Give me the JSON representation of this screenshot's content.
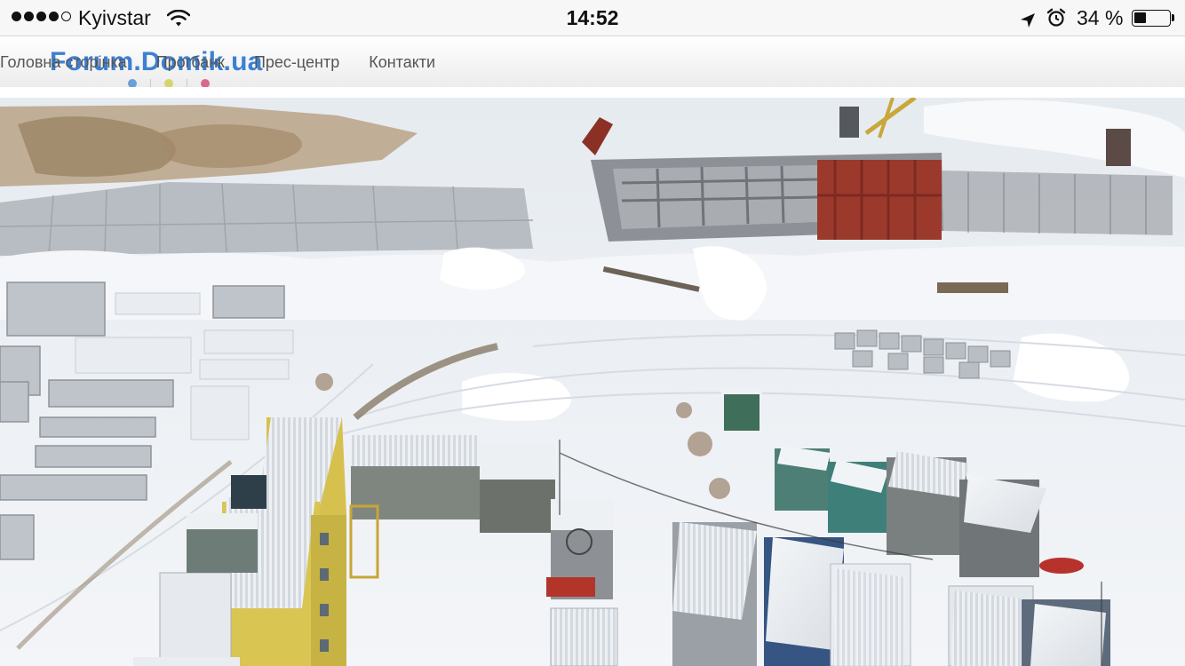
{
  "status_bar": {
    "carrier": "Kyivstar",
    "time": "14:52",
    "battery_percent": "34 %",
    "battery_level": 0.34,
    "icons": [
      "signal-dots-icon",
      "wifi-icon",
      "location-arrow-icon",
      "alarm-clock-icon",
      "battery-icon"
    ]
  },
  "header": {
    "logo": "Forum.Domik.ua",
    "nav": [
      {
        "label": "Головна сторінка"
      },
      {
        "label": "Прогбанк"
      },
      {
        "label": "Прес-центр"
      },
      {
        "label": "Контакти"
      }
    ],
    "logo_dot_colors": [
      "#6a9fd8",
      "#d9d46a",
      "#d86a8a"
    ]
  },
  "main": {
    "image": "construction-site-winter-aerial-photo"
  },
  "colors": {
    "logo": "#3c80d3",
    "nav_text": "#555555",
    "status_text": "#111111"
  }
}
